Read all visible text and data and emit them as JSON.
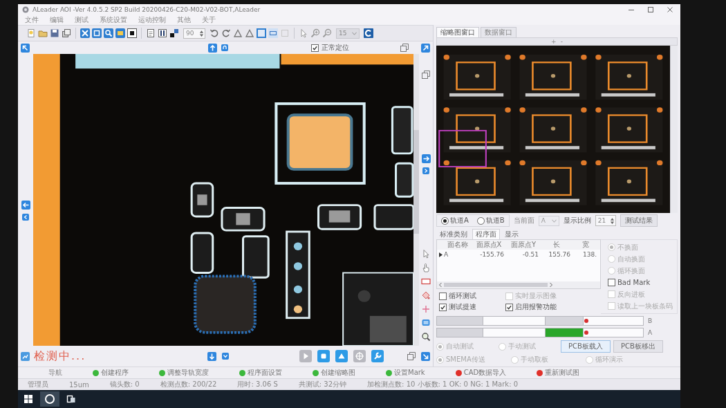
{
  "window": {
    "title": "ALeader AOI -Ver 4.0.5.2 SP2 Build 20200426-C20-M02-V02-BOT,ALeader"
  },
  "menu": [
    "文件",
    "编辑",
    "测试",
    "系统设置",
    "运动控制",
    "其他",
    "关于"
  ],
  "toolbar": {
    "angle": "90",
    "zoom": "15"
  },
  "view": {
    "locate": {
      "label": "正常定位",
      "checked": true
    },
    "status_message": "检测中...",
    "run_controls": [
      {
        "kind": "play",
        "enabled": false
      },
      {
        "kind": "stop",
        "enabled": true
      },
      {
        "kind": "eject",
        "enabled": true
      },
      {
        "kind": "crosshair",
        "enabled": false
      },
      {
        "kind": "wrench",
        "enabled": true
      }
    ]
  },
  "side_panel": {
    "tabs": [
      {
        "label": "缩略图窗口",
        "selected": true
      },
      {
        "label": "数据窗口",
        "selected": false
      }
    ],
    "zoom_controls": [
      "+",
      "-"
    ],
    "tracks": [
      {
        "label": "轨道A",
        "selected": true
      },
      {
        "label": "轨道B",
        "selected": false
      }
    ],
    "current_side": {
      "label": "当前面",
      "value": "A"
    },
    "display_scale": {
      "label": "显示比例",
      "value": "21"
    },
    "result_button": "测试结果",
    "data_tabs": [
      {
        "label": "标准类别",
        "selected": false
      },
      {
        "label": "程序面",
        "selected": true
      },
      {
        "label": "显示",
        "selected": false
      }
    ],
    "table": {
      "columns": [
        "面名称",
        "面原点X",
        "面原点Y",
        "长",
        "宽"
      ],
      "rows": [
        {
          "current": true,
          "cells": [
            "A",
            "-155.76",
            "-0.51",
            "155.76",
            "138."
          ]
        }
      ]
    },
    "side_options": [
      {
        "kind": "radio",
        "label": "不换面",
        "selected": true,
        "disabled": true
      },
      {
        "kind": "radio",
        "label": "自动换面",
        "selected": false,
        "disabled": true
      },
      {
        "kind": "radio",
        "label": "循环换面",
        "selected": false,
        "disabled": true
      },
      {
        "kind": "checkbox",
        "label": "Bad Mark",
        "checked": false,
        "disabled": false
      },
      {
        "kind": "checkbox",
        "label": "反向进板",
        "checked": false,
        "disabled": true
      },
      {
        "kind": "checkbox",
        "label": "读取上一块板条码",
        "checked": false,
        "disabled": true
      }
    ],
    "test_options": [
      {
        "label": "循环测试",
        "checked": false,
        "disabled": false
      },
      {
        "label": "实时显示图像",
        "checked": false,
        "disabled": true
      },
      {
        "label": "测试提速",
        "checked": true,
        "disabled": false
      },
      {
        "label": "启用报警功能",
        "checked": true,
        "disabled": false
      }
    ],
    "conveyor": [
      {
        "label": "B",
        "zones": [
          {
            "occupied": false
          },
          {
            "occupied": false
          }
        ]
      },
      {
        "label": "A",
        "zones": [
          {
            "occupied": false
          },
          {
            "occupied": true
          }
        ]
      }
    ],
    "modes": [
      {
        "label": "自动测试",
        "selected": true,
        "disabled": true
      },
      {
        "label": "手动测试",
        "selected": false,
        "disabled": true
      }
    ],
    "load_buttons": [
      "PCB板载入",
      "PCB板移出"
    ],
    "transfer_options": [
      {
        "label": "SMEMA传送",
        "selected": true,
        "disabled": true
      },
      {
        "label": "手动取板",
        "selected": false,
        "disabled": true
      },
      {
        "label": "循环演示",
        "selected": false,
        "disabled": true
      }
    ]
  },
  "nav": {
    "label": "导航",
    "steps": [
      {
        "label": "创建程序",
        "done": true
      },
      {
        "label": "调整导轨宽度",
        "done": true
      },
      {
        "label": "程序面设置",
        "done": true
      },
      {
        "label": "创建缩略图",
        "done": true
      },
      {
        "label": "设置Mark",
        "done": true
      },
      {
        "label": "CAD数据导入",
        "done": false
      },
      {
        "label": "重新测试图",
        "done": false
      }
    ]
  },
  "status_bar": [
    "管理员",
    "15um",
    "镜头数: 0",
    "检测点数: 200/22",
    "用时: 3.06 S",
    "共测试: 32分钟",
    "加检测点数: 10 小板数: 1 OK: 0 NG: 1 Mark: 0"
  ]
}
